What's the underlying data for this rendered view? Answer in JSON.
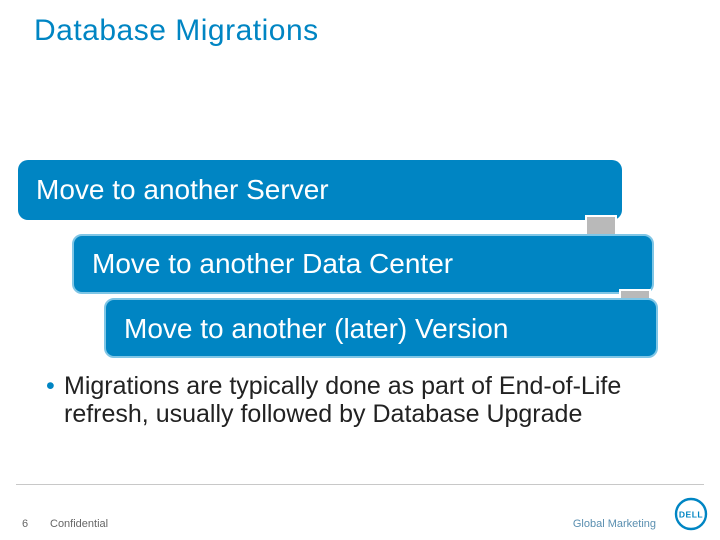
{
  "title": "Database Migrations",
  "boxes": {
    "b1": "Move to another Server",
    "b2": "Move to another Data Center",
    "b3": "Move to another (later) Version"
  },
  "bullet_text": "Migrations are typically done as part of End-of-Life refresh, usually followed by Database Upgrade",
  "footer": {
    "page_number": "6",
    "confidential": "Confidential",
    "global_marketing": "Global Marketing",
    "logo_name": "DELL"
  },
  "colors": {
    "accent": "#0085c3",
    "arrow_fill": "#b9b9b9",
    "arrow_stroke": "#ffffff"
  }
}
